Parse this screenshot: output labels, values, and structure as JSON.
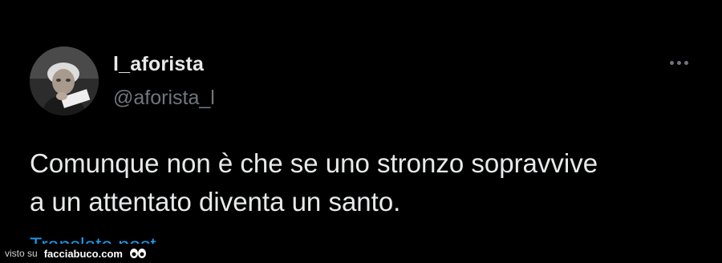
{
  "post": {
    "author": {
      "display_name": "l_aforista",
      "handle": "@aforista_l",
      "avatar_icon": "avatar-photo-icon"
    },
    "more_icon": "more-horizontal-icon",
    "text": "Comunque non è che se uno stronzo sopravvive\na un attentato diventa un santo.",
    "translate_label": "Translate post"
  },
  "watermark": {
    "prefix": "visto su",
    "site": "facciabuco.com",
    "logo_icon": "eyes-logo-icon"
  },
  "colors": {
    "background": "#000000",
    "primary_text": "#e7e9ea",
    "secondary_text": "#71767b",
    "link": "#1d9bf0"
  }
}
